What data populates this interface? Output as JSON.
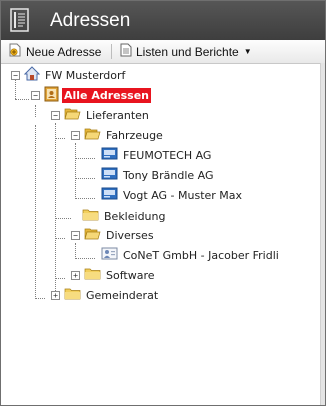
{
  "window": {
    "title": "Adressen"
  },
  "toolbar": {
    "new_label": "Neue Adresse",
    "lists_label": "Listen und Berichte"
  },
  "tree": {
    "root": "FW Musterdorf",
    "all": "Alle Adressen",
    "lieferanten": "Lieferanten",
    "fahrzeuge": "Fahrzeuge",
    "feumotech": "FEUMOTECH AG",
    "braendle": "Tony Brändle AG",
    "vogt": "Vogt AG - Muster Max",
    "bekleidung": "Bekleidung",
    "diverses": "Diverses",
    "conet": "CoNeT GmbH - Jacober Fridli",
    "software": "Software",
    "gemeinderat": "Gemeinderat"
  },
  "colors": {
    "titlebar": "#474747",
    "selected": "#e8141f",
    "folder": "#f0c84a",
    "card": "#2f6fc0"
  },
  "icons": [
    "app-icon",
    "new-address-icon",
    "document-icon",
    "house-icon",
    "address-book-icon",
    "folder-icon",
    "folder-open-icon",
    "contact-card-icon",
    "contact-person-icon"
  ]
}
